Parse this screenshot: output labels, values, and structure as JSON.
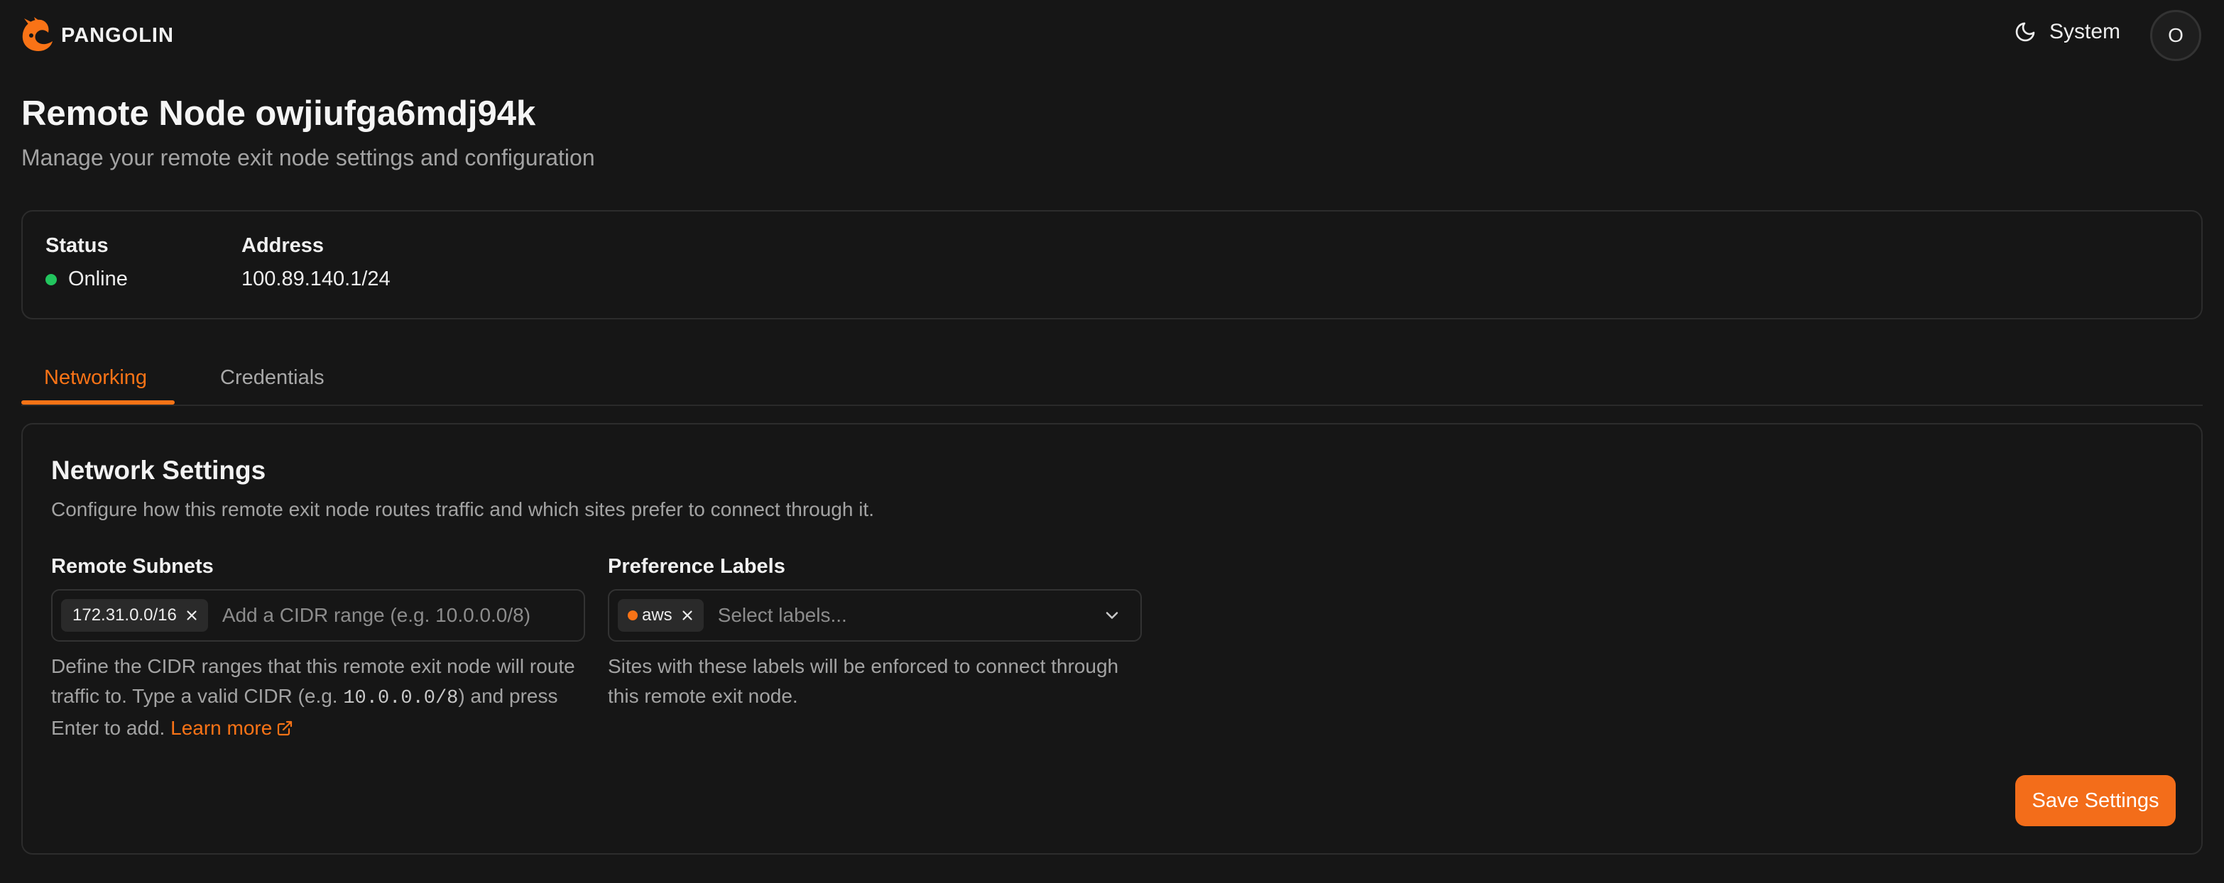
{
  "app": {
    "brand_name": "PANGOLIN",
    "brand_color": "#f97316"
  },
  "header": {
    "theme_label": "System",
    "avatar_initial": "O"
  },
  "page": {
    "title": "Remote Node owjiufga6mdj94k",
    "subtitle": "Manage your remote exit node settings and configuration"
  },
  "info": {
    "status_label": "Status",
    "status_value": "Online",
    "status_color": "#22c55e",
    "address_label": "Address",
    "address_value": "100.89.140.1/24"
  },
  "tabs": [
    {
      "label": "Networking",
      "active": true
    },
    {
      "label": "Credentials",
      "active": false
    }
  ],
  "network_settings": {
    "title": "Network Settings",
    "description": "Configure how this remote exit node routes traffic and which sites prefer to connect through it.",
    "remote_subnets": {
      "label": "Remote Subnets",
      "chips": [
        "172.31.0.0/16"
      ],
      "placeholder": "Add a CIDR range (e.g. 10.0.0.0/8)",
      "help_part1": "Define the CIDR ranges that this remote exit node will route traffic to. Type a valid CIDR (e.g. ",
      "help_code": "10.0.0.0/8",
      "help_part2": ") and press Enter to add.",
      "learn_more": "Learn more"
    },
    "preference_labels": {
      "label": "Preference Labels",
      "chips": [
        "aws"
      ],
      "placeholder": "Select labels...",
      "help": "Sites with these labels will be enforced to connect through this remote exit node."
    },
    "save_label": "Save Settings"
  }
}
